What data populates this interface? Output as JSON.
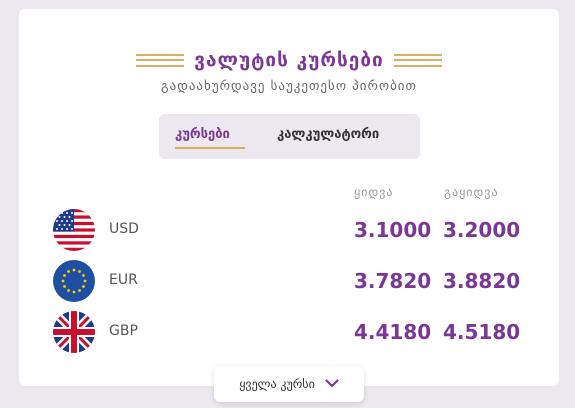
{
  "header": {
    "title": "ვალუტის კურსები",
    "subtitle": "გადაახურდავე საუკეთესო პირობით"
  },
  "tabs": [
    {
      "label": "კურსები",
      "active": true
    },
    {
      "label": "კალკულატორი",
      "active": false
    }
  ],
  "table": {
    "columns": [
      "ყიდვა",
      "გაყიდვა"
    ],
    "rows": [
      {
        "code": "USD",
        "buy": "3.1000",
        "sell": "3.2000",
        "flag": "us-flag-icon"
      },
      {
        "code": "EUR",
        "buy": "3.7820",
        "sell": "3.8820",
        "flag": "eu-flag-icon"
      },
      {
        "code": "GBP",
        "buy": "4.4180",
        "sell": "4.5180",
        "flag": "gb-flag-icon"
      }
    ]
  },
  "footer": {
    "all_rates_label": "ყველა კურსი",
    "icon": "chevron-down-icon"
  },
  "colors": {
    "accent": "#7b3795",
    "gold": "#d7b068",
    "background": "#ece8ef"
  }
}
